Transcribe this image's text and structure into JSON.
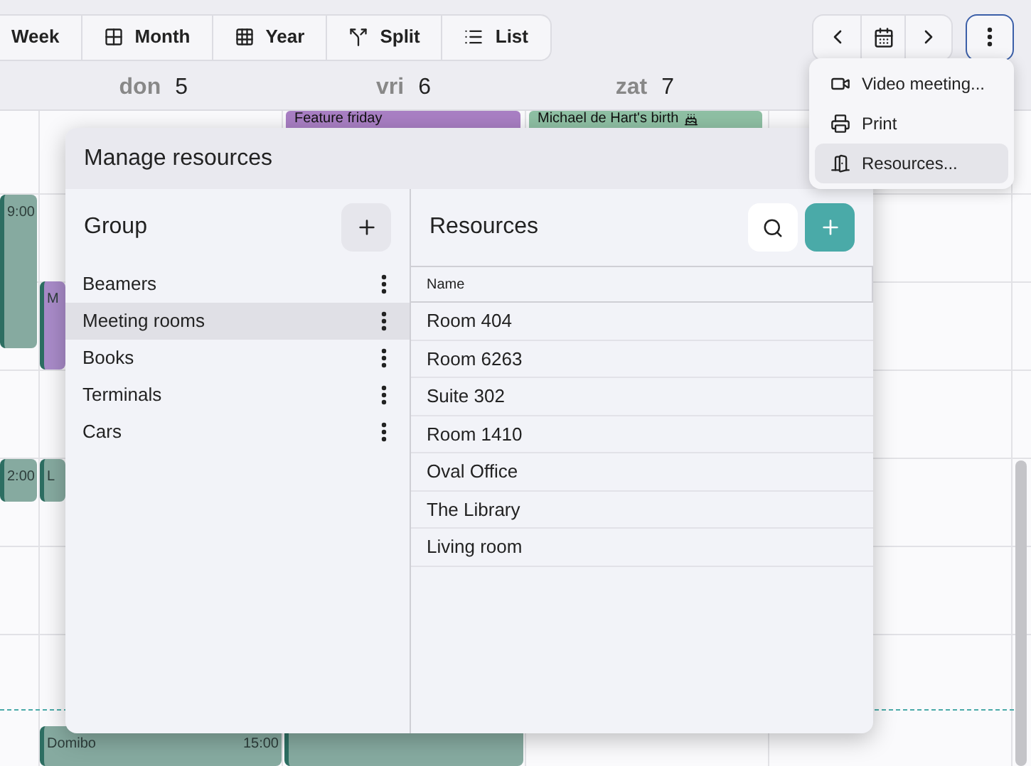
{
  "toolbar": {
    "views": [
      {
        "label": "Week",
        "kind": "week"
      },
      {
        "label": "Month",
        "kind": "month"
      },
      {
        "label": "Year",
        "kind": "year"
      },
      {
        "label": "Split",
        "kind": "split"
      },
      {
        "label": "List",
        "kind": "list"
      }
    ]
  },
  "more_menu": {
    "expanded": true,
    "items": [
      {
        "label": "Video meeting...",
        "kind": "video",
        "selected": false
      },
      {
        "label": "Print",
        "kind": "print",
        "selected": false
      },
      {
        "label": "Resources...",
        "kind": "resources",
        "selected": true
      }
    ]
  },
  "calendar": {
    "days": [
      {
        "weekday": "don",
        "day": "5"
      },
      {
        "weekday": "vri",
        "day": "6"
      },
      {
        "weekday": "zat",
        "day": "7"
      }
    ],
    "all_day_events": [
      {
        "title": "Feature friday",
        "color": "#a97fc4"
      },
      {
        "title": "Michael de Hart's birth",
        "color": "#8fc0a4"
      }
    ],
    "events": [
      {
        "time": "9:00",
        "color": "#86aaa0"
      },
      {
        "title": "M",
        "color": "#a98bc9"
      },
      {
        "time": "2:00",
        "color": "#86aaa0"
      },
      {
        "title": "L",
        "color": "#86aaa0"
      },
      {
        "title": "Domibo",
        "time": "15:00",
        "color": "#86aaa0"
      },
      {
        "color": "#86aaa0"
      }
    ]
  },
  "dialog": {
    "title": "Manage resources",
    "group_panel": {
      "title": "Group",
      "items": [
        {
          "label": "Beamers",
          "selected": false
        },
        {
          "label": "Meeting rooms",
          "selected": true
        },
        {
          "label": "Books",
          "selected": false
        },
        {
          "label": "Terminals",
          "selected": false
        },
        {
          "label": "Cars",
          "selected": false
        }
      ]
    },
    "resources_panel": {
      "title": "Resources",
      "table": {
        "columns": [
          "Name"
        ],
        "rows": [
          "Room 404",
          "Room 6263",
          "Suite 302",
          "Room 1410",
          "Oval Office",
          "The Library",
          "Living room"
        ]
      }
    }
  }
}
